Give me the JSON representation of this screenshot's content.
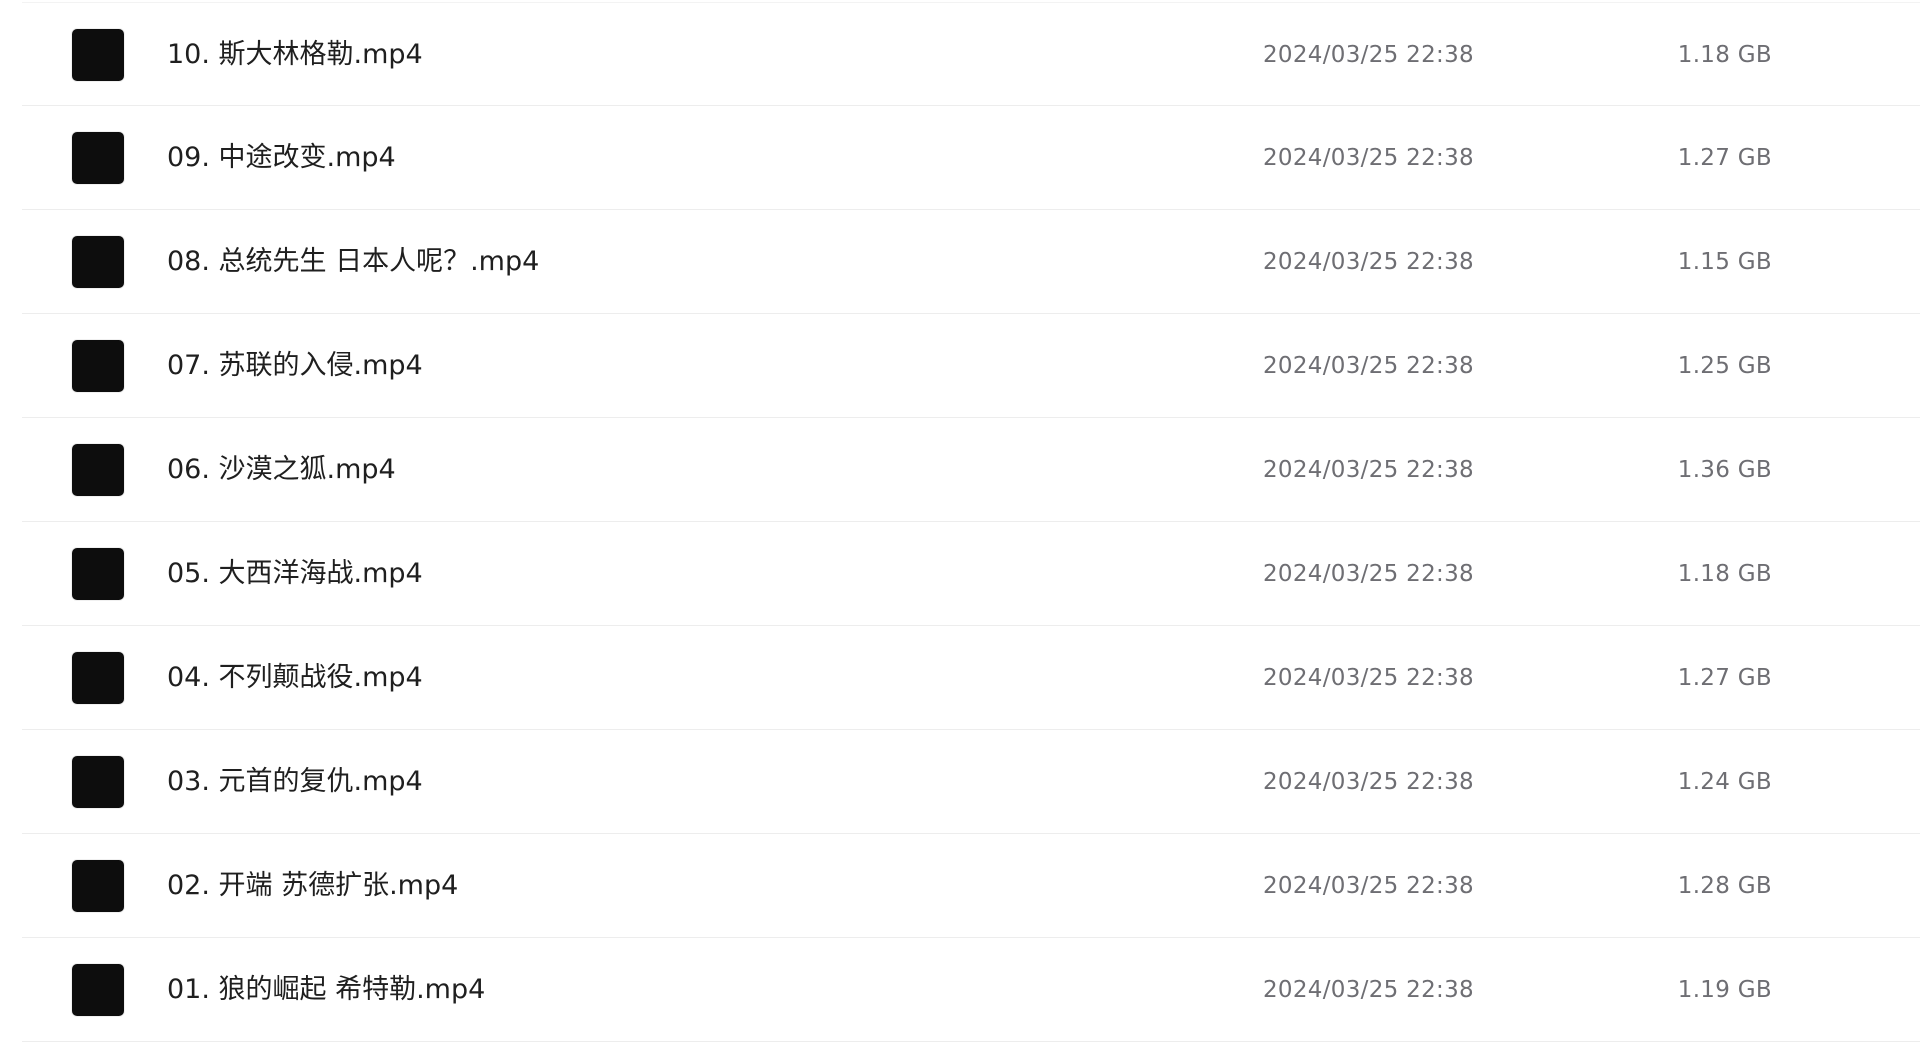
{
  "files": [
    {
      "name": "10. 斯大林格勒.mp4",
      "modified": "2024/03/25 22:38",
      "size": "1.18 GB",
      "thumbnail": "video-thumbnail"
    },
    {
      "name": "09. 中途改变.mp4",
      "modified": "2024/03/25 22:38",
      "size": "1.27 GB",
      "thumbnail": "video-thumbnail"
    },
    {
      "name": "08. 总统先生 日本人呢？.mp4",
      "modified": "2024/03/25 22:38",
      "size": "1.15 GB",
      "thumbnail": "video-thumbnail"
    },
    {
      "name": "07. 苏联的入侵.mp4",
      "modified": "2024/03/25 22:38",
      "size": "1.25 GB",
      "thumbnail": "video-thumbnail"
    },
    {
      "name": "06. 沙漠之狐.mp4",
      "modified": "2024/03/25 22:38",
      "size": "1.36 GB",
      "thumbnail": "video-thumbnail"
    },
    {
      "name": "05. 大西洋海战.mp4",
      "modified": "2024/03/25 22:38",
      "size": "1.18 GB",
      "thumbnail": "video-thumbnail"
    },
    {
      "name": "04. 不列颠战役.mp4",
      "modified": "2024/03/25 22:38",
      "size": "1.27 GB",
      "thumbnail": "video-thumbnail"
    },
    {
      "name": "03. 元首的复仇.mp4",
      "modified": "2024/03/25 22:38",
      "size": "1.24 GB",
      "thumbnail": "video-thumbnail"
    },
    {
      "name": "02. 开端 苏德扩张.mp4",
      "modified": "2024/03/25 22:38",
      "size": "1.28 GB",
      "thumbnail": "video-thumbnail"
    },
    {
      "name": "01. 狼的崛起 希特勒.mp4",
      "modified": "2024/03/25 22:38",
      "size": "1.19 GB",
      "thumbnail": "video-thumbnail"
    }
  ],
  "colors": {
    "thumbnail": "#0d0d0d",
    "name_text": "#1f1f1f",
    "meta_text": "#6e6e73",
    "divider": "#ededed"
  }
}
